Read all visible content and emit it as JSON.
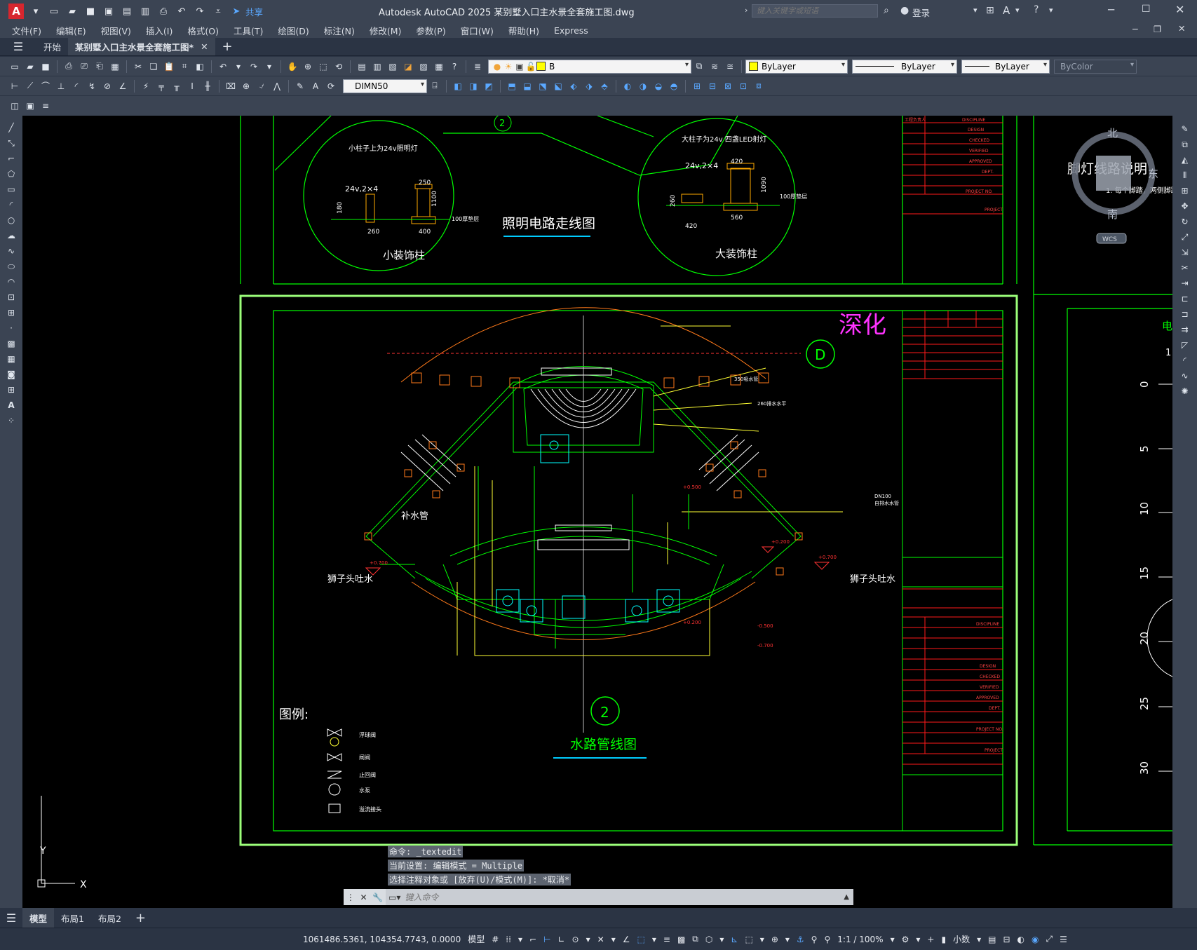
{
  "app": {
    "title": "Autodesk AutoCAD 2025    某别墅入口主水景全套施工图.dwg",
    "logo_letter": "A",
    "share_label": "共享",
    "search_placeholder": "键入关键字或短语",
    "login_label": "登录"
  },
  "menu": [
    "文件(F)",
    "编辑(E)",
    "视图(V)",
    "插入(I)",
    "格式(O)",
    "工具(T)",
    "绘图(D)",
    "标注(N)",
    "修改(M)",
    "参数(P)",
    "窗口(W)",
    "帮助(H)",
    "Express"
  ],
  "doc_tabs": {
    "start": "开始",
    "active": "某别墅入口主水景全套施工图*"
  },
  "toolbar": {
    "layer_name": "B",
    "color": "ByLayer",
    "linetype": "ByLayer",
    "lineweight": "ByLayer",
    "plotstyle": "ByColor",
    "dimstyle": "DIMN50"
  },
  "viewcube": {
    "north": "北",
    "south": "南",
    "east": "东",
    "wcs": "WCS"
  },
  "drawing": {
    "sheet_top": {
      "title": "照明电路走线图",
      "detail_small_title": "小装饰柱",
      "detail_small_note": "小柱子上为24v照明灯",
      "detail_small_v": "24v,2×4",
      "detail_small_d1": "250",
      "detail_small_d2": "1100",
      "detail_small_d3": "260",
      "detail_small_d4": "400",
      "detail_small_d5": "180",
      "detail_small_label": "100厚垫层",
      "detail_large_title": "大装饰柱",
      "detail_large_note": "大柱子为24v 四盏LED射灯",
      "detail_large_v": "24v,2×4",
      "detail_large_d1": "420",
      "detail_large_d2": "560",
      "detail_large_d3": "1090",
      "detail_large_d4": "420",
      "detail_large_d5": "260",
      "detail_large_label": "100厚垫层",
      "marker": "2"
    },
    "sheet_main": {
      "title": "水路管线图",
      "marker": "2",
      "deepen": "深化",
      "grid_letter": "D",
      "legend_title": "图例:",
      "legend_items": [
        "浮球阀",
        "闸阀",
        "止回阀",
        "水泵",
        "溢流接头"
      ],
      "labels": {
        "bushui": "补水管",
        "lion_left": "狮子头吐水",
        "lion_right": "狮子头吐水",
        "pipe_350": "350吸水管",
        "pipe_260": "260排水水平",
        "dn100_right": "DN100",
        "dn100_note": "自排水水管",
        "elev_left": "+0.700",
        "elev_right": "+0.700",
        "elev_1": "+0.500",
        "elev_2": "+0.200",
        "elev_3": "+0.200",
        "elev_4": "-0.500",
        "elev_5": "-0.700"
      }
    },
    "sheet_right": {
      "title": "脚灯线路说明",
      "note": "1. 每个脚踏，两侧脚踏",
      "scale_ticks": [
        "0",
        "5",
        "10",
        "15",
        "20",
        "25",
        "30"
      ],
      "side_char": "电",
      "side_num": "1"
    },
    "title_block_rows": [
      "DISCIPLINE",
      "DESIGN",
      "CHECKED",
      "VERIFIED",
      "APPROVED",
      "DEPT.",
      "PROJECT NO.",
      "PROJECT"
    ]
  },
  "command": {
    "history": [
      "命令: _textedit",
      "当前设置: 编辑模式 = Multiple",
      "选择注释对象或 [放弃(U)/模式(M)]: *取消*"
    ],
    "placeholder": "键入命令"
  },
  "layout_tabs": [
    "模型",
    "布局1",
    "布局2"
  ],
  "status": {
    "coords": "1061486.5361, 104354.7743, 0.0000",
    "model": "模型",
    "scale": "1:1 / 100%",
    "units": "小数"
  }
}
